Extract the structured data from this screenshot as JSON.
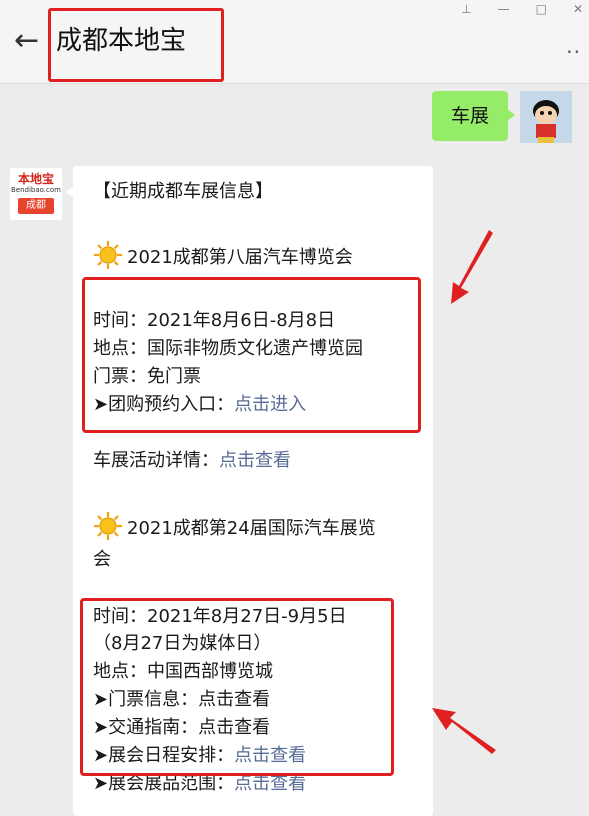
{
  "window": {
    "pin": "ꟷ",
    "minimize": "—",
    "maximize": "□",
    "close": "✕"
  },
  "header": {
    "back": "←",
    "title": "成都本地宝",
    "more": "··"
  },
  "sent_message": {
    "text": "车展"
  },
  "bot": {
    "logo_top": "本地宝",
    "logo_sub": "Bendibao.com",
    "logo_city": "成都"
  },
  "message": {
    "heading": "【近期成都车展信息】",
    "event1": {
      "title": "2021成都第八届汽车博览会",
      "time": "时间：2021年8月6日-8月8日",
      "place": "地点：国际非物质文化遗产博览园",
      "ticket": "门票：免门票",
      "group_label": "➤团购预约入口：",
      "group_link": "点击进入"
    },
    "details": {
      "label": "车展活动详情：",
      "link": "点击查看"
    },
    "event2": {
      "title_line1": "2021成都第24届国际汽车展览",
      "title_line2": "会",
      "time": "时间：2021年8月27日-9月5日",
      "note": "（8月27日为媒体日）",
      "place": "地点：中国西部博览城",
      "ticket_label": "➤门票信息：",
      "ticket_link": "点击查看",
      "traffic_label": "➤交通指南：",
      "traffic_link": "点击查看",
      "schedule_label": "➤展会日程安排：",
      "schedule_link": "点击查看",
      "scope_label": "➤展会展品范围：",
      "scope_link": "点击查看"
    }
  },
  "colors": {
    "highlight": "#e02020",
    "link": "#576b95",
    "sent_bubble": "#95ec69"
  },
  "icons": [
    "back-arrow-icon",
    "pin-icon",
    "minimize-icon",
    "maximize-icon",
    "close-icon",
    "more-icon",
    "sun-icon",
    "red-arrow-icon"
  ]
}
